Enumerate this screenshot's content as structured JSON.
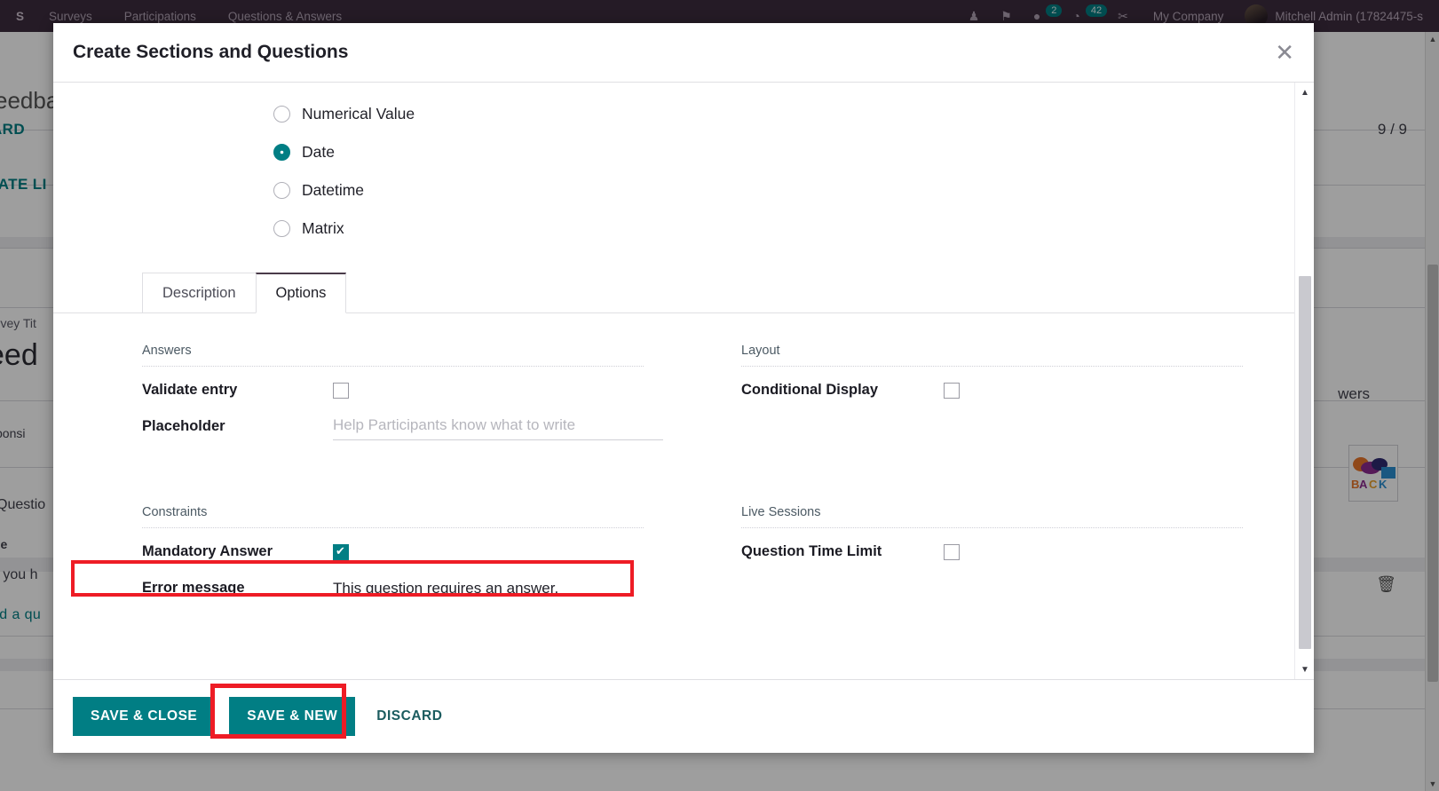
{
  "topbar": {
    "brand": "S",
    "menu": [
      "Surveys",
      "Participations",
      "Questions & Answers"
    ],
    "icons": [
      {
        "name": "bug-icon",
        "glyph": "♟"
      },
      {
        "name": "pin-icon",
        "glyph": "⚑"
      },
      {
        "name": "chat-icon",
        "glyph": "●",
        "badge": "2"
      },
      {
        "name": "activity-icon",
        "glyph": "◔",
        "badge": "42"
      },
      {
        "name": "tools-icon",
        "glyph": "✂"
      }
    ],
    "company": "My Company",
    "username": "Mitchell Admin (17824475-s"
  },
  "background": {
    "breadcrumb": "eedba",
    "btn_dashboard": "ARD",
    "btn_create": "EATE LI",
    "counter": "9 / 9",
    "survey_title_label": "urvey Tit",
    "survey_title_value": "eed",
    "responsible_label": "sponsi",
    "tab_questions": "Questio",
    "col_title": "tle",
    "row_question": "o you h",
    "row_add": "dd a qu",
    "answers_col": "wers",
    "logo_text": "ACK",
    "trash_icon": "🗑"
  },
  "modal": {
    "title": "Create Sections and Questions",
    "close_icon": "✕",
    "question_types": [
      {
        "label": "Numerical Value",
        "checked": false
      },
      {
        "label": "Date",
        "checked": true
      },
      {
        "label": "Datetime",
        "checked": false
      },
      {
        "label": "Matrix",
        "checked": false
      }
    ],
    "tabs": [
      {
        "label": "Description",
        "active": false
      },
      {
        "label": "Options",
        "active": true
      }
    ],
    "options": {
      "answers": {
        "group_title": "Answers",
        "validate_entry_label": "Validate entry",
        "validate_entry_checked": false,
        "placeholder_label": "Placeholder",
        "placeholder_value": "",
        "placeholder_hint": "Help Participants know what to write"
      },
      "layout": {
        "group_title": "Layout",
        "conditional_display_label": "Conditional Display",
        "conditional_display_checked": false
      },
      "constraints": {
        "group_title": "Constraints",
        "mandatory_answer_label": "Mandatory Answer",
        "mandatory_answer_checked": true,
        "error_message_label": "Error message",
        "error_message_value": "This question requires an answer."
      },
      "live_sessions": {
        "group_title": "Live Sessions",
        "question_time_limit_label": "Question Time Limit",
        "question_time_limit_checked": false
      }
    },
    "footer": {
      "save_close_label": "SAVE & CLOSE",
      "save_new_label": "SAVE & NEW",
      "discard_label": "DISCARD"
    },
    "scrollbar": {
      "up_arrow": "▲",
      "down_arrow": "▼"
    }
  },
  "colors": {
    "accent": "#017e84",
    "topbar": "#3c2c3e",
    "highlight": "#ee1c25"
  }
}
